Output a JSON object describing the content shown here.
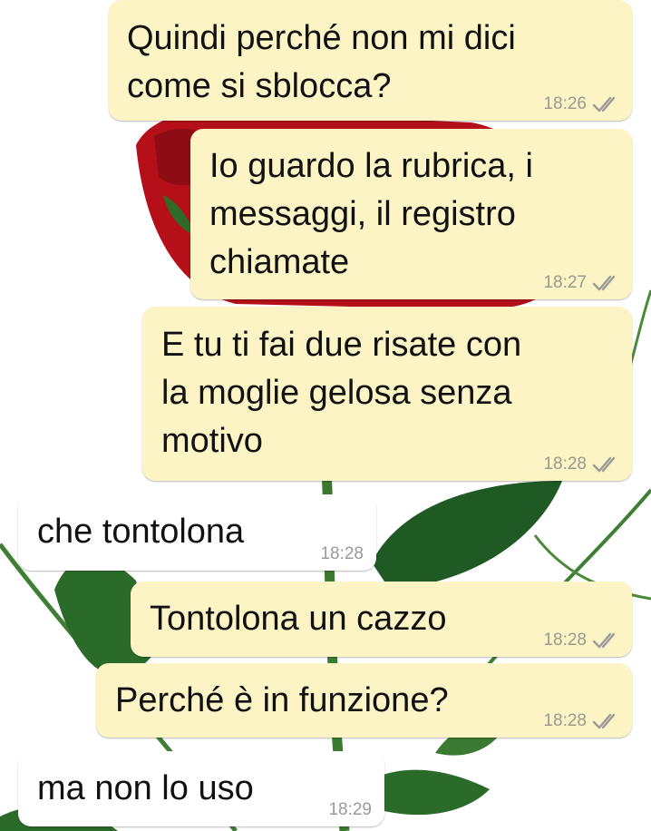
{
  "chat": {
    "messages": [
      {
        "direction": "outgoing",
        "text": "Quindi perché non mi dici\ncome si sblocca?",
        "time": "18:26",
        "status": "double-check-icon"
      },
      {
        "direction": "outgoing",
        "text": "Io guardo la rubrica, i\nmessaggi, il registro\nchiamate",
        "time": "18:27",
        "status": "double-check-icon"
      },
      {
        "direction": "outgoing",
        "text": "E tu ti fai due risate con\nla moglie gelosa senza\nmotivo",
        "time": "18:28",
        "status": "double-check-icon"
      },
      {
        "direction": "incoming",
        "text": "che tontolona",
        "time": "18:28"
      },
      {
        "direction": "outgoing",
        "text": "Tontolona un cazzo",
        "time": "18:28",
        "status": "double-check-icon"
      },
      {
        "direction": "outgoing",
        "text": "Perché è in funzione?",
        "time": "18:28",
        "status": "double-check-icon"
      },
      {
        "direction": "incoming",
        "text": "ma non lo uso",
        "time": "18:29"
      }
    ]
  },
  "colors": {
    "outgoing_bubble": "#fcf4c5",
    "incoming_bubble": "#ffffff",
    "timestamp": "#9a9a8c",
    "ticks": "#9a9a9a"
  },
  "wallpaper": {
    "icon": "red-rose-wallpaper"
  }
}
